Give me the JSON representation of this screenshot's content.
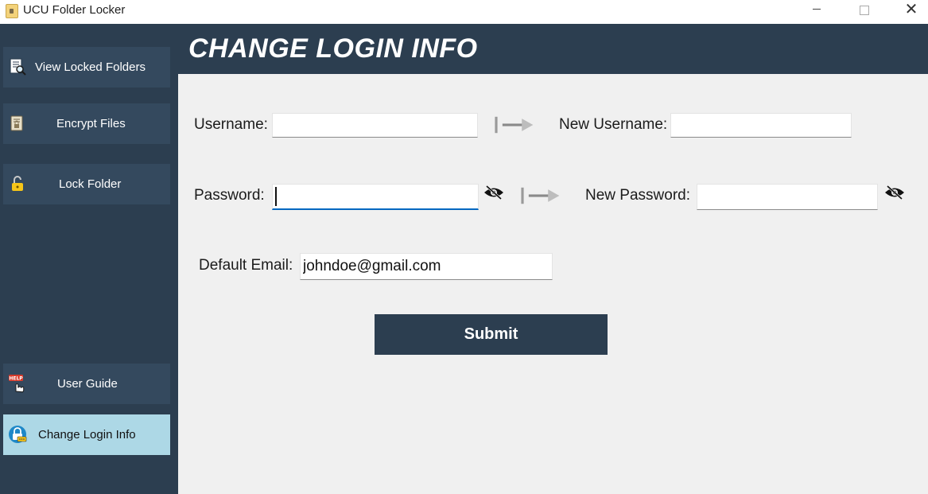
{
  "window": {
    "title": "UCU Folder Locker",
    "close_glyph": "✕"
  },
  "sidebar": {
    "items": [
      {
        "label": "View Locked Folders",
        "icon": "search-document-icon"
      },
      {
        "label": "Encrypt Files",
        "icon": "encrypted-file-icon"
      },
      {
        "label": "Lock Folder",
        "icon": "padlock-icon"
      },
      {
        "label": "User Guide",
        "icon": "help-hand-icon"
      },
      {
        "label": "Change Login Info",
        "icon": "lock-user-icon",
        "active": true
      }
    ]
  },
  "header": {
    "title": "CHANGE LOGIN INFO"
  },
  "form": {
    "username_label": "Username:",
    "username_value": "",
    "new_username_label": "New Username:",
    "new_username_value": "",
    "password_label": "Password:",
    "password_value": "",
    "new_password_label": "New Password:",
    "new_password_value": "",
    "email_label": "Default Email:",
    "email_value": "johndoe@gmail.com",
    "submit_label": "Submit"
  },
  "colors": {
    "sidebar_bg": "#2c3e50",
    "nav_item_bg": "#34495e",
    "active_item_bg": "#add8e6",
    "content_bg": "#f0f0f0",
    "focus_accent": "#0067c0"
  }
}
